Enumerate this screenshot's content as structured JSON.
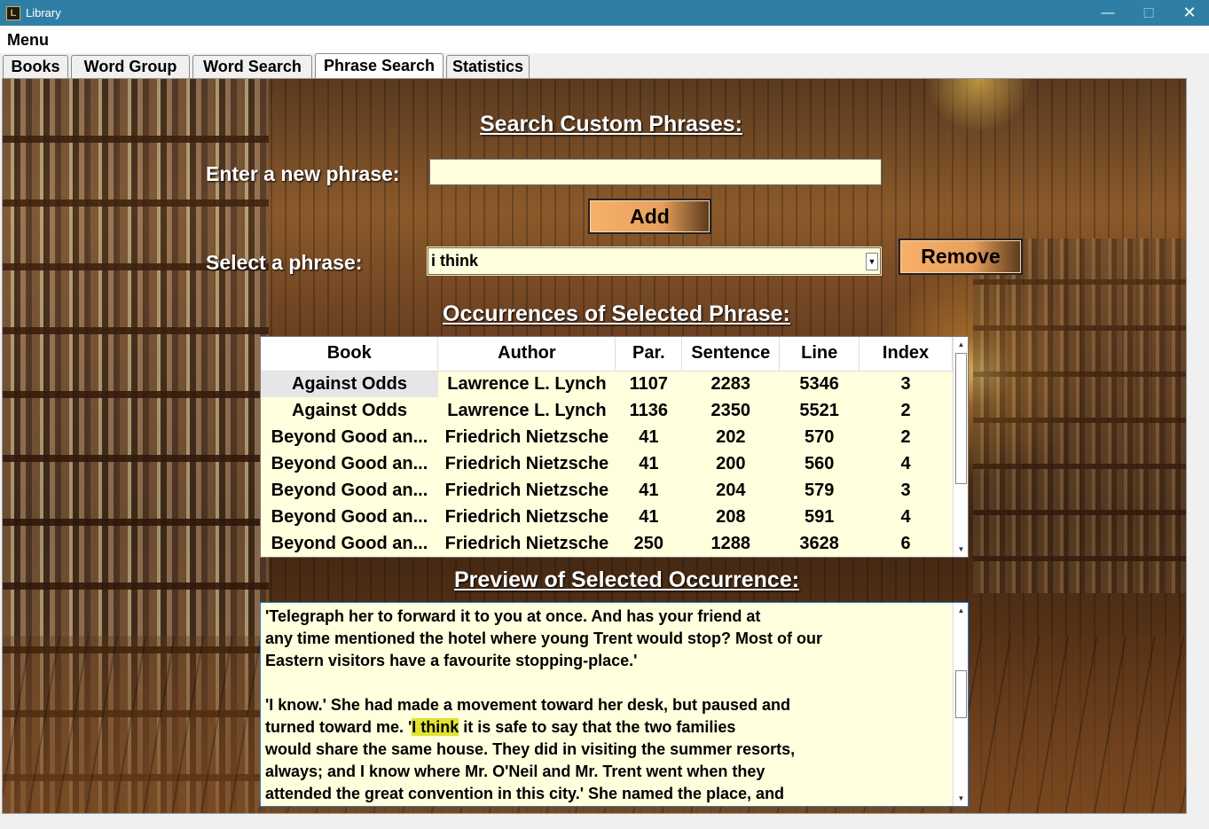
{
  "window": {
    "title": "Library",
    "minimize": "—",
    "maximize": "☐",
    "close": "✕"
  },
  "menu": {
    "label": "Menu"
  },
  "tabs": [
    {
      "label": "Books",
      "active": false
    },
    {
      "label": "Word Group",
      "active": false
    },
    {
      "label": "Word Search",
      "active": false
    },
    {
      "label": "Phrase Search",
      "active": true
    },
    {
      "label": "Statistics",
      "active": false
    }
  ],
  "phrase_search": {
    "title": "Search Custom Phrases:",
    "new_phrase_label": "Enter a new phrase:",
    "new_phrase_value": "",
    "add_button": "Add",
    "select_label": "Select a phrase:",
    "selected_phrase": "i think",
    "remove_button": "Remove",
    "occurrences_title": "Occurrences of Selected Phrase:",
    "preview_title": "Preview of Selected Occurrence:"
  },
  "occurrences": {
    "columns": [
      "Book",
      "Author",
      "Par.",
      "Sentence",
      "Line",
      "Index"
    ],
    "rows": [
      [
        "Against Odds",
        "Lawrence L. Lynch",
        "1107",
        "2283",
        "5346",
        "3"
      ],
      [
        "Against Odds",
        "Lawrence L. Lynch",
        "1136",
        "2350",
        "5521",
        "2"
      ],
      [
        "Beyond Good an...",
        "Friedrich Nietzsche",
        "41",
        "202",
        "570",
        "2"
      ],
      [
        "Beyond Good an...",
        "Friedrich Nietzsche",
        "41",
        "200",
        "560",
        "4"
      ],
      [
        "Beyond Good an...",
        "Friedrich Nietzsche",
        "41",
        "204",
        "579",
        "3"
      ],
      [
        "Beyond Good an...",
        "Friedrich Nietzsche",
        "41",
        "208",
        "591",
        "4"
      ],
      [
        "Beyond Good an...",
        "Friedrich Nietzsche",
        "250",
        "1288",
        "3628",
        "6"
      ]
    ]
  },
  "preview": {
    "before": "'Telegraph her to forward it to you at once. And has your friend at\nany time mentioned the hotel where young Trent would stop? Most of our\nEastern visitors have a favourite stopping-place.'\n\n'I know.' She had made a movement toward her desk, but paused and\nturned toward me. '",
    "highlight": "I think",
    "after": " it is safe to say that the two families\nwould share the same house. They did in visiting the summer resorts,\nalways; and I know where Mr. O'Neil and Mr. Trent went when they\nattended the great convention in this city.' She named the place, and"
  }
}
